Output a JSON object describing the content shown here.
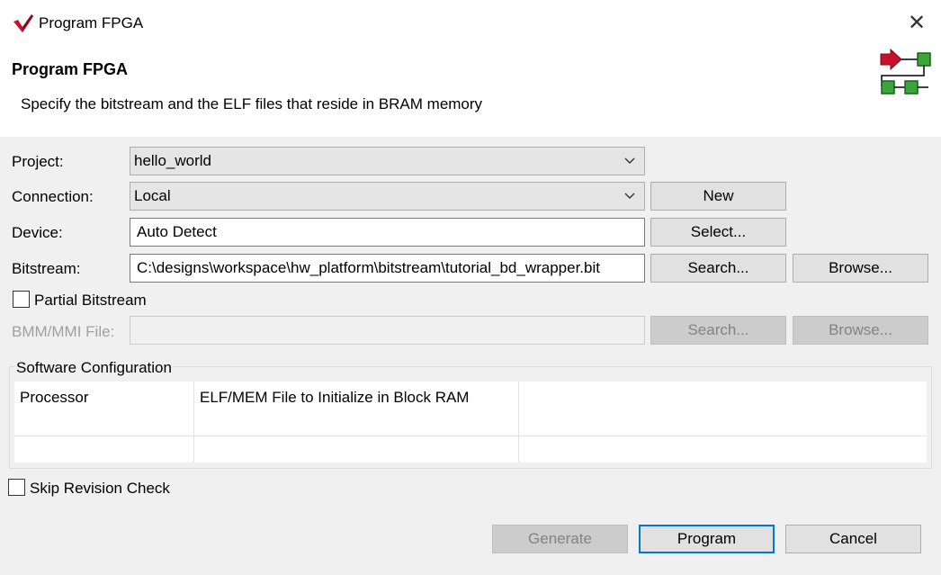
{
  "window": {
    "title": "Program FPGA",
    "app_icon": "xilinx-logo-icon",
    "close_icon": "close-icon",
    "close_glyph": "✕"
  },
  "banner": {
    "title": "Program FPGA",
    "description": "Specify the bitstream and the ELF files that reside in BRAM memory",
    "graphic_icon": "fpga-program-icon"
  },
  "form": {
    "project_label": "Project:",
    "project_value": "hello_world",
    "connection_label": "Connection:",
    "connection_value": "Local",
    "device_label": "Device:",
    "device_value": "Auto Detect",
    "bitstream_label": "Bitstream:",
    "bitstream_value": "C:\\designs\\workspace\\hw_platform\\bitstream\\tutorial_bd_wrapper.bit",
    "partial_bitstream_label": "Partial Bitstream",
    "partial_bitstream_checked": false,
    "bmm_label": "BMM/MMI File:",
    "bmm_value": ""
  },
  "buttons": {
    "new": "New",
    "select": "Select...",
    "bitstream_search": "Search...",
    "bitstream_browse": "Browse...",
    "bmm_search": "Search...",
    "bmm_browse": "Browse...",
    "generate": "Generate",
    "program": "Program",
    "cancel": "Cancel"
  },
  "software_config": {
    "title": "Software Configuration",
    "columns": [
      "Processor",
      "ELF/MEM File to Initialize in Block RAM",
      ""
    ],
    "rows": [
      [
        "",
        "",
        ""
      ]
    ]
  },
  "skip_revision": {
    "label": "Skip Revision Check",
    "checked": false
  },
  "colors": {
    "accent": "#0078d7",
    "logo_red": "#c8102e",
    "graphic_green": "#2e9a2e"
  }
}
